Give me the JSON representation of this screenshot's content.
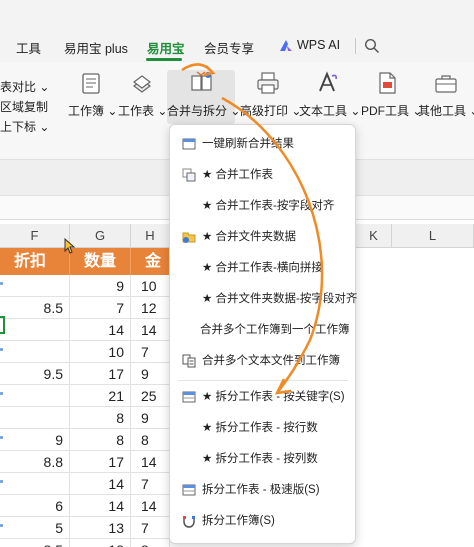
{
  "menu": {
    "tabs": [
      {
        "label": "工具"
      },
      {
        "label": "易用宝 plus"
      },
      {
        "label": "易用宝"
      },
      {
        "label": "会员专享"
      },
      {
        "label": "WPS AI"
      }
    ]
  },
  "ribbon": {
    "left_cmds": [
      "表对比",
      "区域复制",
      "上下标"
    ],
    "buttons": [
      {
        "label": "工作簿"
      },
      {
        "label": "工作表"
      },
      {
        "label": "合并与拆分"
      },
      {
        "label": "高级打印"
      },
      {
        "label": "文本工具"
      },
      {
        "label": "PDF工具"
      },
      {
        "label": "其他工具"
      }
    ]
  },
  "sheet": {
    "columns": [
      "F",
      "G",
      "H",
      "I",
      "J",
      "K",
      "L"
    ],
    "headers": {
      "f": "折扣",
      "g": "数量",
      "h": "金额"
    },
    "rows": [
      {
        "f": "",
        "g": "9",
        "h": "10"
      },
      {
        "f": "8.5",
        "g": "7",
        "h": "12"
      },
      {
        "f": "",
        "g": "14",
        "h": "14"
      },
      {
        "f": "",
        "g": "10",
        "h": "7"
      },
      {
        "f": "9.5",
        "g": "17",
        "h": "9"
      },
      {
        "f": "",
        "g": "21",
        "h": "25"
      },
      {
        "f": "",
        "g": "8",
        "h": "9"
      },
      {
        "f": "9",
        "g": "8",
        "h": "8"
      },
      {
        "f": "8.8",
        "g": "17",
        "h": "14"
      },
      {
        "f": "",
        "g": "14",
        "h": "7"
      },
      {
        "f": "6",
        "g": "14",
        "h": "14"
      },
      {
        "f": "5",
        "g": "13",
        "h": "7"
      },
      {
        "f": "8.5",
        "g": "18",
        "h": "8"
      }
    ]
  },
  "dropdown": {
    "items": [
      {
        "label": "一键刷新合并结果",
        "icon": "refresh-table-icon"
      },
      {
        "label": "★ 合并工作表",
        "icon": "merge-sheets-icon"
      },
      {
        "label": "★ 合并工作表-按字段对齐",
        "icon": ""
      },
      {
        "label": "★ 合并文件夹数据",
        "icon": "folder-merge-icon"
      },
      {
        "label": "★ 合并工作表-横向拼接",
        "icon": ""
      },
      {
        "label": "★ 合并文件夹数据-按字段对齐",
        "icon": ""
      },
      {
        "label": "合并多个工作簿到一个工作簿",
        "icon": ""
      },
      {
        "label": "合并多个文本文件到工作簿",
        "icon": "merge-text-files-icon"
      },
      {
        "label": "★ 拆分工作表 - 按关键字(S)",
        "icon": "split-sheet-icon"
      },
      {
        "label": "★ 拆分工作表 - 按行数",
        "icon": ""
      },
      {
        "label": "★ 拆分工作表 - 按列数",
        "icon": ""
      },
      {
        "label": "拆分工作表 - 极速版(S)",
        "icon": "split-fast-icon"
      },
      {
        "label": "拆分工作簿(S)",
        "icon": "split-workbook-icon"
      }
    ]
  },
  "colors": {
    "accent_green": "#1f8f3b",
    "header_orange": "#e8833a",
    "arrow_orange": "#f08a24"
  }
}
